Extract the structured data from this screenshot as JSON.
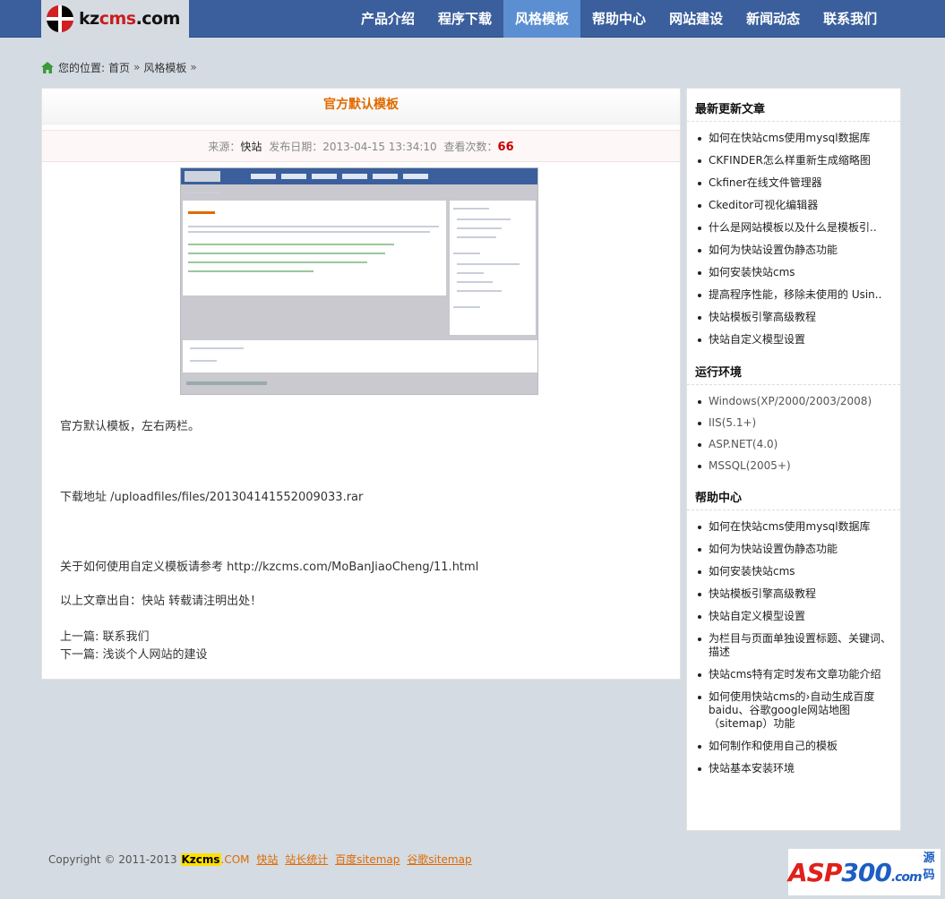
{
  "header": {
    "logo": {
      "part1": "kz",
      "part2": "cms",
      "part3": ".com"
    },
    "nav": [
      {
        "label": "产品介绍",
        "active": false
      },
      {
        "label": "程序下载",
        "active": false
      },
      {
        "label": "风格模板",
        "active": true
      },
      {
        "label": "帮助中心",
        "active": false
      },
      {
        "label": "网站建设",
        "active": false
      },
      {
        "label": "新闻动态",
        "active": false
      },
      {
        "label": "联系我们",
        "active": false
      }
    ]
  },
  "breadcrumb": {
    "prefix": "您的位置:",
    "home": "首页",
    "sep": "»",
    "current": "风格模板",
    "trail": "»"
  },
  "article": {
    "title": "官方默认模板",
    "meta": {
      "source_label": "来源：",
      "source": "快站",
      "date_label": "发布日期：",
      "date": "2013-04-15 13:34:10",
      "views_label": "查看次数：",
      "views": "66"
    },
    "intro": "官方默认模板，左右两栏。",
    "download": "下载地址 /uploadfiles/files/201304141552009033.rar",
    "reference": "关于如何使用自定义模板请参考  http://kzcms.com/MoBanJiaoCheng/11.html",
    "copyright_note": "以上文章出自：快站  转载请注明出处！",
    "prev": "上一篇: 联系我们",
    "next": "下一篇: 浅谈个人网站的建设"
  },
  "sidebar": {
    "latest": {
      "title": "最新更新文章",
      "items": [
        "如何在快站cms使用mysql数据库",
        "CKFINDER怎么样重新生成缩略图",
        "Ckfiner在线文件管理器",
        "Ckeditor可视化编辑器",
        "什么是网站模板以及什么是模板引..",
        "如何为快站设置伪静态功能",
        "如何安装快站cms",
        "提高程序性能，移除未使用的 Usin..",
        "快站模板引擎高级教程",
        "快站自定义模型设置"
      ]
    },
    "env": {
      "title": "运行环境",
      "items": [
        "Windows(XP/2000/2003/2008)",
        "IIS(5.1+)",
        "ASP.NET(4.0)",
        "MSSQL(2005+)"
      ]
    },
    "help": {
      "title": "帮助中心",
      "items": [
        "如何在快站cms使用mysql数据库",
        "如何为快站设置伪静态功能",
        "如何安装快站cms",
        "快站模板引擎高级教程",
        "快站自定义模型设置",
        "为栏目与页面单独设置标题、关键词、描述",
        "快站cms特有定时发布文章功能介绍",
        "如何使用快站cms的›自动生成百度baidu、谷歌google网站地图（sitemap）功能",
        "如何制作和使用自己的模板",
        "快站基本安装环境"
      ]
    }
  },
  "footer": {
    "copyright": "Copyright © 2011-2013",
    "brand": "Kzcms",
    "dotcom": ".COM",
    "links": [
      "快站",
      "站长统计",
      "百度sitemap",
      "谷歌sitemap"
    ]
  },
  "watermark": {
    "text_a": "ASP",
    "text_b": "300",
    "text_c": ".com",
    "cn": "源码"
  },
  "colors": {
    "nav_bg": "#3a5f9c",
    "nav_active": "#5b8fd1",
    "title_orange": "#e06a00",
    "views_red": "#cc0000",
    "page_bg": "#d4dbe2"
  }
}
